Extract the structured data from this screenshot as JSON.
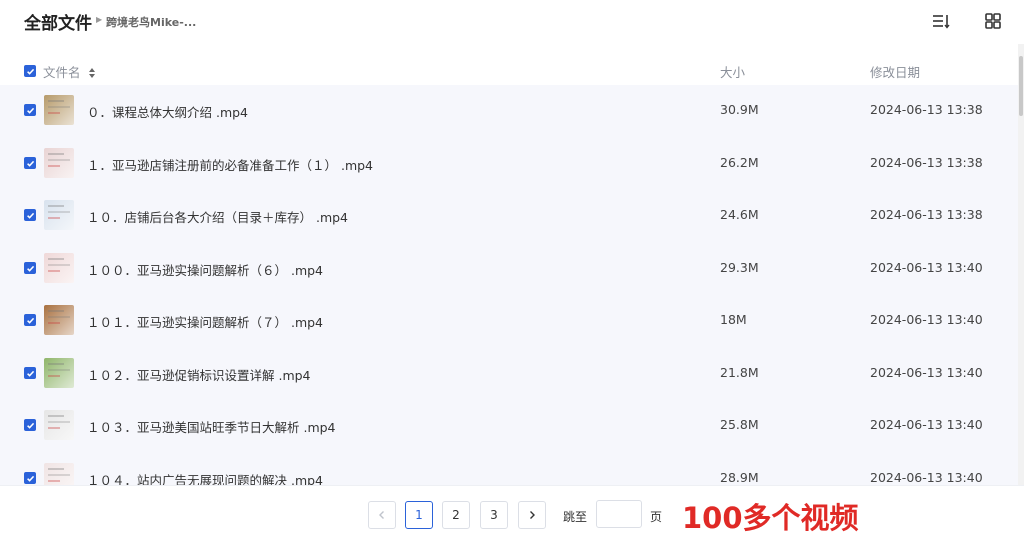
{
  "header": {
    "title": "全部文件",
    "breadcrumb": "跨境老鸟Mike-...",
    "list_view_icon": "list-sort-icon",
    "grid_view_icon": "grid-view-icon"
  },
  "columns": {
    "name": "文件名",
    "size": "大小",
    "date": "修改日期"
  },
  "files": [
    {
      "name": "０．课程总体大纲介绍 .mp4",
      "size": "30.9M",
      "date": "2024-06-13 13:38",
      "thumb_color": "#b69a6a"
    },
    {
      "name": "１．亚马逊店铺注册前的必备准备工作（１） .mp4",
      "size": "26.2M",
      "date": "2024-06-13 13:38",
      "thumb_color": "#e9d4d4"
    },
    {
      "name": "１０．店铺后台各大介绍（目录＋库存） .mp4",
      "size": "24.6M",
      "date": "2024-06-13 13:38",
      "thumb_color": "#d8e2ee"
    },
    {
      "name": "１００．亚马逊实操问题解析（６） .mp4",
      "size": "29.3M",
      "date": "2024-06-13 13:40",
      "thumb_color": "#efd8d8"
    },
    {
      "name": "１０１．亚马逊实操问题解析（７） .mp4",
      "size": "18M",
      "date": "2024-06-13 13:40",
      "thumb_color": "#a8703f"
    },
    {
      "name": "１０２．亚马逊促销标识设置详解 .mp4",
      "size": "21.8M",
      "date": "2024-06-13 13:40",
      "thumb_color": "#8fb56a"
    },
    {
      "name": "１０３．亚马逊美国站旺季节日大解析 .mp4",
      "size": "25.8M",
      "date": "2024-06-13 13:40",
      "thumb_color": "#e6e6e6"
    },
    {
      "name": "１０４．站内广告无展现问题的解决 .mp4",
      "size": "28.9M",
      "date": "2024-06-13 13:40",
      "thumb_color": "#f0e4e4"
    }
  ],
  "pagination": {
    "prev_icon": "chevron-left-icon",
    "pages": [
      "1",
      "2",
      "3"
    ],
    "current_page": "1",
    "next_icon": "chevron-right-icon",
    "jump_label": "跳至",
    "jump_value": "",
    "page_unit": "页"
  },
  "promo_text": "100多个视频",
  "colors": {
    "accent": "#2b62d9",
    "promo": "#e02a26",
    "row_bg": "#f6f7fc"
  }
}
